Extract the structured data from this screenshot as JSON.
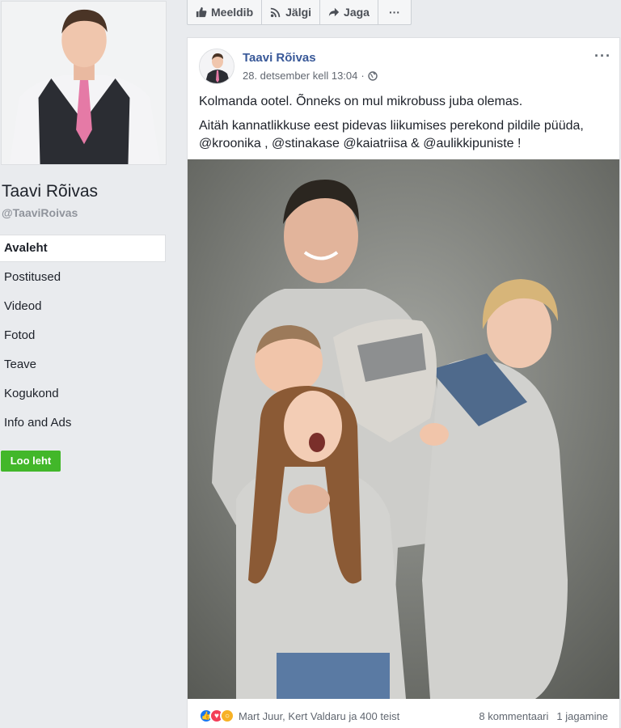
{
  "sidebar": {
    "page_name": "Taavi Rõivas",
    "handle": "@TaaviRoivas",
    "nav": [
      "Avaleht",
      "Postitused",
      "Videod",
      "Fotod",
      "Teave",
      "Kogukond",
      "Info and Ads"
    ],
    "create_page": "Loo leht"
  },
  "actionbar": {
    "like": "Meeldib",
    "follow": "Jälgi",
    "share": "Jaga",
    "more": "···"
  },
  "post": {
    "author": "Taavi Rõivas",
    "date": "28. detsember kell 13:04",
    "separator": "·",
    "privacy_icon": "globe-icon",
    "text1": "Kolmanda ootel. Õnneks on mul mikrobuss juba olemas.",
    "text2": "Aitäh kannatlikkuse eest pidevas liikumises perekond pildile püüda, @kroonika , @stinakase @kaiatriisa & @aulikkipuniste !",
    "more": "···"
  },
  "footer": {
    "reaction_icons": [
      "like-icon",
      "love-icon",
      "wow-icon"
    ],
    "reactors": "Mart Juur, Kert Valdaru ja 400 teist",
    "comments": "8 kommentaari",
    "shares": "1 jagamine"
  },
  "colors": {
    "link": "#385898",
    "green": "#42b72a",
    "like": "#1877f2",
    "love": "#f33e58",
    "wow": "#f7b125"
  }
}
